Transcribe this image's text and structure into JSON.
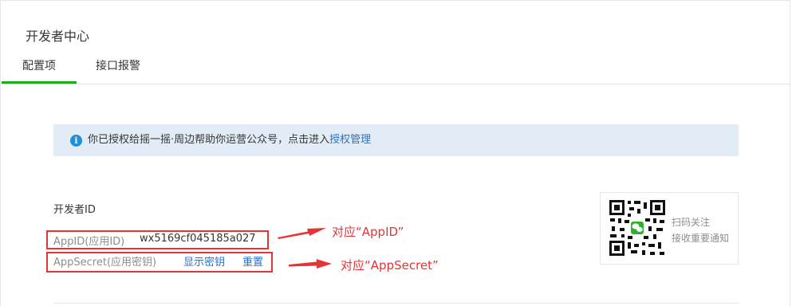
{
  "page": {
    "title": "开发者中心"
  },
  "tabs": [
    {
      "label": "配置项",
      "active": true
    },
    {
      "label": "接口报警",
      "active": false
    }
  ],
  "notice": {
    "icon": "info-icon",
    "text": "你已授权给摇一摇·周边帮助你运营公众号，点击进入",
    "link": "授权管理"
  },
  "developer_id": {
    "section_label": "开发者ID",
    "appid_label": "AppID(应用ID)",
    "appid_value": "wx5169cf045185a027",
    "secret_label": "AppSecret(应用密钥)",
    "show_secret": "显示密钥",
    "reset": "重置"
  },
  "annotations": {
    "appid": "对应“AppID”",
    "secret": "对应“AppSecret”",
    "color": "#e63434"
  },
  "qr_card": {
    "line1": "扫码关注",
    "line2": "接收重要通知",
    "icon": "qr-code-icon"
  },
  "colors": {
    "accent": "#1aad19",
    "link": "#2a71c6",
    "notice_bg": "#e2ecf6",
    "info": "#1d8fdb"
  }
}
